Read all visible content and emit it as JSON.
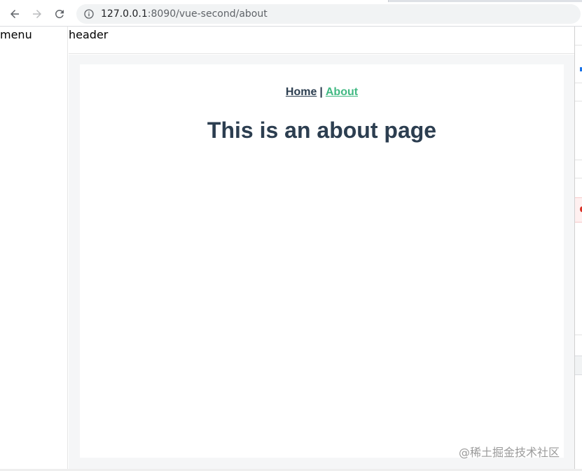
{
  "browser": {
    "url_host": "127.0.0.1",
    "url_rest": ":8090/vue-second/about",
    "icons": [
      "back-arrow-icon",
      "forward-arrow-icon",
      "reload-icon",
      "info-icon"
    ]
  },
  "layout": {
    "menu_label": "menu",
    "header_label": "header"
  },
  "nav": {
    "home_label": "Home",
    "separator": "|",
    "about_label": "About"
  },
  "main": {
    "heading": "This is an about page"
  },
  "colors": {
    "text_dark": "#2c3e50",
    "active_link": "#42b983",
    "main_bg": "#f5f6f7"
  },
  "watermark": "@稀土掘金技术社区"
}
